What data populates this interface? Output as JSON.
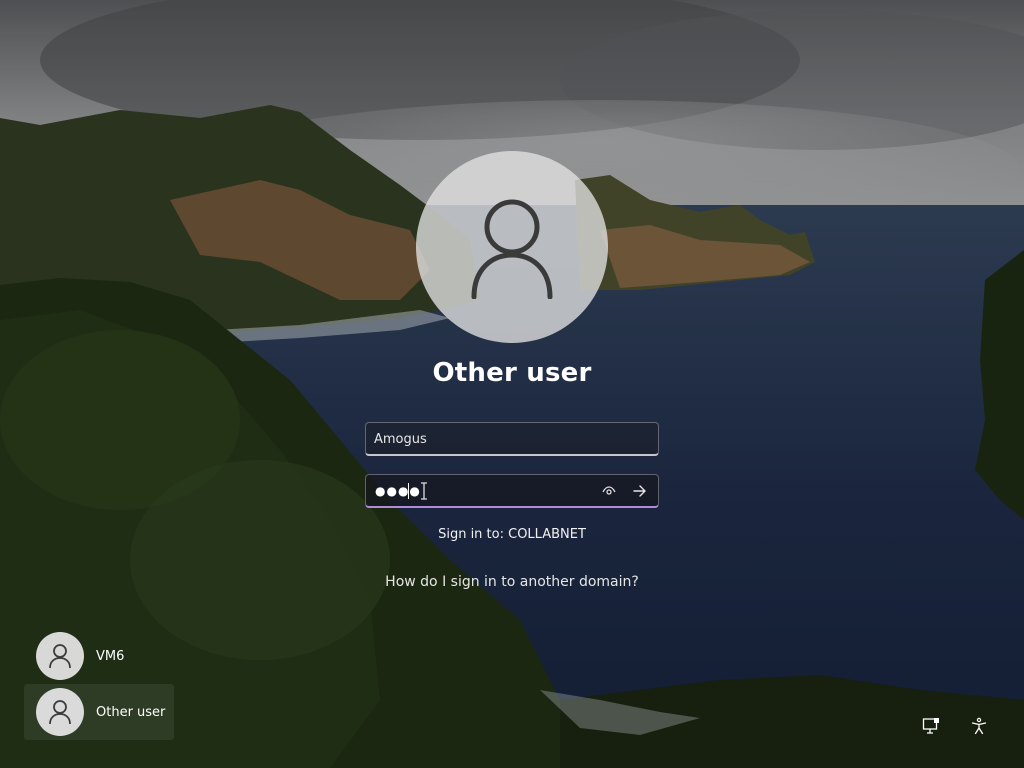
{
  "login": {
    "display_name": "Other user",
    "username_value": "Amogus",
    "password_mask": "●●●●",
    "sign_in_to": "Sign in to: COLLABNET",
    "domain_help_link": "How do I sign in to another domain?"
  },
  "user_list": [
    {
      "label": "VM6"
    },
    {
      "label": "Other user"
    }
  ],
  "icons": {
    "reveal": "eye-icon",
    "submit": "arrow-right-icon",
    "network": "network-icon",
    "accessibility": "accessibility-icon"
  },
  "colors": {
    "password_focus_border": "#b38ad8",
    "avatar_fill": "#e1e1e1"
  }
}
